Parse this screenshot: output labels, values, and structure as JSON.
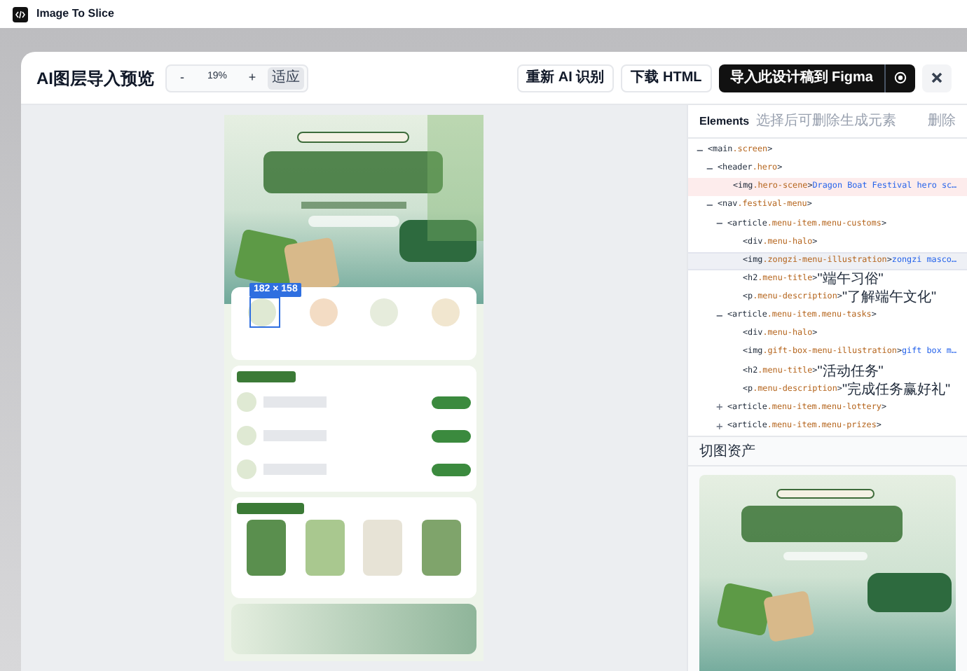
{
  "app": {
    "title": "Image To Slice"
  },
  "dialog": {
    "title": "AI图层导入预览",
    "zoom": {
      "minus": "-",
      "value": "19%",
      "plus": "+",
      "fit": "适应"
    },
    "actions": [
      {
        "label": "重新 AI 识别",
        "kind": "secondary"
      },
      {
        "label": "下载 HTML",
        "kind": "secondary"
      },
      {
        "label": "导入此设计稿到 Figma",
        "kind": "primary"
      }
    ]
  },
  "canvas": {
    "selection": {
      "size": "182 × 158"
    }
  },
  "elements_panel": {
    "title": "Elements",
    "hint": "选择后可删除生成元素",
    "delete": "删除",
    "tree": [
      {
        "tag": "<main",
        "cls": ".screen",
        "end": ">",
        "toggle": "−",
        "expanded": true,
        "selected": false,
        "hovered": false,
        "children": [
          {
            "tag": "<header",
            "cls": ".hero",
            "end": ">",
            "toggle": "−",
            "expanded": true,
            "selected": false,
            "hovered": false,
            "children": [
              {
                "tag": "<img",
                "cls": ".hero-scene",
                "end": ">",
                "content": "Dragon Boat Festival hero sc…",
                "kind": "alt",
                "selected": true,
                "hovered": false
              }
            ]
          },
          {
            "tag": "<nav",
            "cls": ".festival-menu",
            "end": ">",
            "toggle": "−",
            "expanded": true,
            "selected": false,
            "hovered": false,
            "children": [
              {
                "tag": "<article",
                "cls": ".menu-item.menu-customs",
                "end": ">",
                "toggle": "−",
                "expanded": true,
                "selected": false,
                "hovered": false,
                "children": [
                  {
                    "tag": "<div",
                    "cls": ".menu-halo",
                    "end": ">",
                    "selected": false,
                    "hovered": false
                  },
                  {
                    "tag": "<img",
                    "cls": ".zongzi-menu-illustration",
                    "end": ">",
                    "content": "zongzi masco…",
                    "kind": "alt",
                    "selected": false,
                    "hovered": true
                  },
                  {
                    "tag": "<h2",
                    "cls": ".menu-title",
                    "end": ">",
                    "content": "\"端午习俗\"",
                    "kind": "string",
                    "selected": false,
                    "hovered": false
                  },
                  {
                    "tag": "<p",
                    "cls": ".menu-description",
                    "end": ">",
                    "content": "\"了解端午文化\"",
                    "kind": "string",
                    "selected": false,
                    "hovered": false
                  }
                ]
              },
              {
                "tag": "<article",
                "cls": ".menu-item.menu-tasks",
                "end": ">",
                "toggle": "−",
                "expanded": true,
                "selected": false,
                "hovered": false,
                "children": [
                  {
                    "tag": "<div",
                    "cls": ".menu-halo",
                    "end": ">",
                    "selected": false,
                    "hovered": false
                  },
                  {
                    "tag": "<img",
                    "cls": ".gift-box-menu-illustration",
                    "end": ">",
                    "content": "gift box m…",
                    "kind": "alt",
                    "selected": false,
                    "hovered": false
                  },
                  {
                    "tag": "<h2",
                    "cls": ".menu-title",
                    "end": ">",
                    "content": "\"活动任务\"",
                    "kind": "string",
                    "selected": false,
                    "hovered": false
                  },
                  {
                    "tag": "<p",
                    "cls": ".menu-description",
                    "end": ">",
                    "content": "\"完成任务赢好礼\"",
                    "kind": "string",
                    "selected": false,
                    "hovered": false
                  }
                ]
              },
              {
                "tag": "<article",
                "cls": ".menu-item.menu-lottery",
                "end": ">",
                "toggle": "+",
                "expanded": false,
                "selected": false,
                "hovered": false
              },
              {
                "tag": "<article",
                "cls": ".menu-item.menu-prizes",
                "end": ">",
                "toggle": "+",
                "expanded": false,
                "selected": false,
                "hovered": false
              }
            ]
          }
        ]
      }
    ]
  },
  "assets_panel": {
    "title": "切图资产"
  }
}
